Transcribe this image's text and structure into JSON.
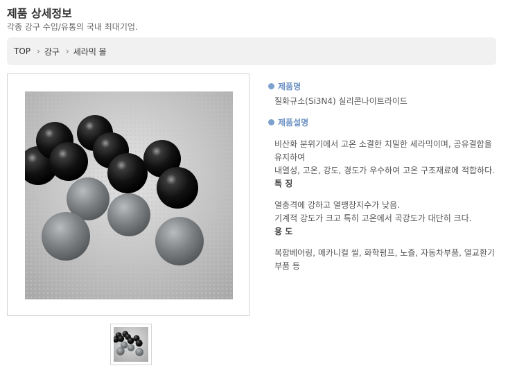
{
  "page": {
    "title": "제품 상세정보",
    "subtitle": "각종 강구 수입/유통의 국내 최대기업."
  },
  "breadcrumb": {
    "items": [
      "TOP",
      "강구",
      "세라믹 볼"
    ]
  },
  "product": {
    "name_heading": "제품명",
    "name": "질화규소(Si3N4) 실리콘나이트라이드",
    "desc_heading": "제품설명",
    "desc_lines": [
      "비산화 분위기에서 고온 소결한 치밀한 세라믹이며, 공유결합을 유지하여",
      "내열성, 고온, 강도, 경도가 우수하여 고온 구조재료에 적합하다."
    ],
    "features_heading": "특 징",
    "features_lines": [
      "열충격에 강하고 열팽창지수가 낮음.",
      "기계적 강도가 크고 특히 고온에서 곡강도가 대단히 크다."
    ],
    "uses_heading": "용 도",
    "uses_lines": [
      "복합베어링, 메카니컬 씰, 화학펌프, 노즐, 자동차부품, 열교환기 부품 등"
    ]
  },
  "icons": {
    "breadcrumb_separator": "chevron-right-icon",
    "section_bullet": "circle-bullet-icon"
  },
  "colors": {
    "section_heading": "#6f93c4",
    "breadcrumb_bg": "#f1f1f1"
  }
}
